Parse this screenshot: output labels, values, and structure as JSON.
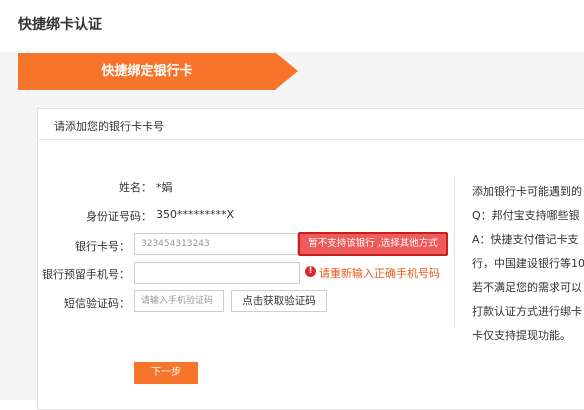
{
  "page_title": "快捷绑卡认证",
  "step": {
    "label": "快捷绑定银行卡"
  },
  "card": {
    "header": "请添加您的银行卡卡号"
  },
  "form": {
    "name_label": "姓名：",
    "name_value": "*娟",
    "id_label": "身份证号码：",
    "id_value": "350*********X",
    "bank_card_label": "银行卡号：",
    "bank_card_value": "323454313243",
    "phone_label": "银行预留手机号：",
    "phone_value": "",
    "sms_label": "短信验证码：",
    "sms_placeholder": "请输入手机验证码",
    "sms_button": "点击获取验证码",
    "next_button": "下一步"
  },
  "errors": {
    "card_error": "暂不支持该银行 ,选择其他方式",
    "phone_error": "请重新输入正确手机号码",
    "warning_glyph": "!"
  },
  "side_help": {
    "lines": [
      "添加银行卡可能遇到的",
      "Q：邦付宝支持哪些银",
      "A：快捷支付借记卡支",
      "行，中国建设银行等10",
      "若不满足您的需求可以",
      "打款认证方式进行绑卡",
      "卡仅支持提现功能。"
    ]
  },
  "colors": {
    "accent": "#f7752a",
    "error": "#ef5a5a",
    "warning_text": "#e45b1c"
  }
}
